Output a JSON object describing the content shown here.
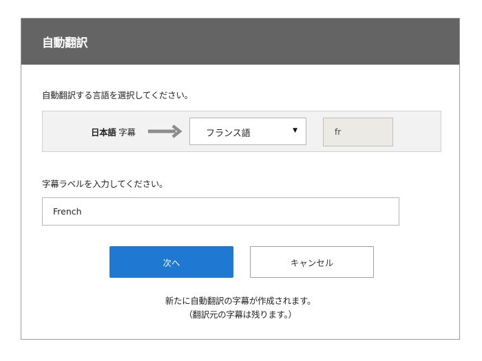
{
  "dialog": {
    "title": "自動翻訳"
  },
  "language_section": {
    "instruction": "自動翻訳する言語を選択してください。",
    "source_language_name": "日本語",
    "source_type": "字幕",
    "target_language_selected": "フランス語",
    "target_language_code": "fr"
  },
  "label_section": {
    "instruction": "字幕ラベルを入力してください。",
    "label_value": "French"
  },
  "buttons": {
    "next_label": "次へ",
    "cancel_label": "キャンセル"
  },
  "note": {
    "line1": "新たに自動翻訳の字幕が作成されます。",
    "line2": "（翻訳元の字幕は残ります。）"
  },
  "colors": {
    "header_bg": "#646464",
    "primary_button": "#1f78d1",
    "arrow": "#8c8c8c"
  },
  "icons": {
    "arrow": "arrow-right-icon",
    "caret": "caret-down-icon"
  }
}
